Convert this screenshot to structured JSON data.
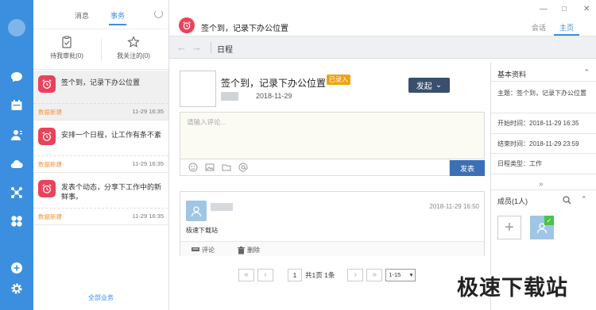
{
  "left_tabs": {
    "messages": "消息",
    "tasks": "事务"
  },
  "filters": {
    "pending": "待我审批(0)",
    "followed": "我关注的(0)"
  },
  "cards": [
    {
      "title": "签个到，记录下办公位置",
      "tag": "数据新建",
      "time": "11-29 16:35"
    },
    {
      "title": "安排一个日程，让工作有条不紊",
      "tag": "数据新建",
      "time": "11-29 16:35"
    },
    {
      "title": "发表个动态，分享下工作中的新鲜事。",
      "tag": "数据新建",
      "time": "11-29 16:35"
    }
  ],
  "all_business": "全部业务",
  "header": {
    "title": "签个到，记录下办公位置",
    "tab_chat": "会话",
    "tab_home": "主页",
    "min": "—",
    "max": "□",
    "close": "✕"
  },
  "nav": {
    "back": "←",
    "forward": "→",
    "crumb": "日程"
  },
  "task": {
    "title": "签个到，记录下办公位置",
    "badge": "已录入",
    "date": "2018-11-29",
    "initiate": "发起"
  },
  "comment": {
    "placeholder": "请输入评论...",
    "send": "发表"
  },
  "entry": {
    "datetime": "2018-11-29 16:50",
    "text": "极速下载站",
    "comment_btn": "评论",
    "delete_btn": "删除"
  },
  "pager": {
    "page": "1",
    "summary": "共1页 1条",
    "per_page": "1-15"
  },
  "info": {
    "heading": "基本资料",
    "subject": "主题：签个到，记录下办公位置",
    "start": "开始时间：2018-11-29 16:35",
    "end": "结束时间：2018-11-29 23:59",
    "type": "日程类型：工作"
  },
  "members": {
    "heading": "成员(1人)",
    "add": "+"
  },
  "watermark": "极速下载站",
  "colors": {
    "rail": "#3b8fde",
    "accent": "#3b8fde",
    "event_icon": "#e9435a",
    "badge": "#f0a20a",
    "initiate_btn": "#3a4f6e",
    "send_btn": "#3b70b5"
  }
}
